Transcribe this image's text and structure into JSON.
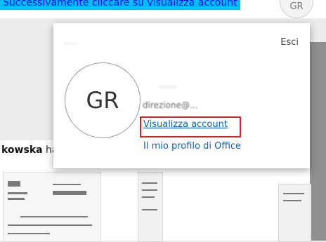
{
  "caption": "Successivamente cliccare su visualizza account",
  "header": {
    "avatar_initials": "GR"
  },
  "account_panel": {
    "account_name": "......",
    "sign_out_label": "Esci",
    "avatar_initials": "GR",
    "display_name": "......",
    "email": "direzione@...",
    "view_account_label": "Visualizza account",
    "office_profile_label": "Il mio profilo di Office",
    "highlight_color": "#e02020"
  },
  "background": {
    "notification_name": "kowska",
    "notification_suffix": " ha"
  },
  "colors": {
    "link": "#0563c1",
    "caption_bg": "#00bfff",
    "caption_text": "#0000ff"
  }
}
